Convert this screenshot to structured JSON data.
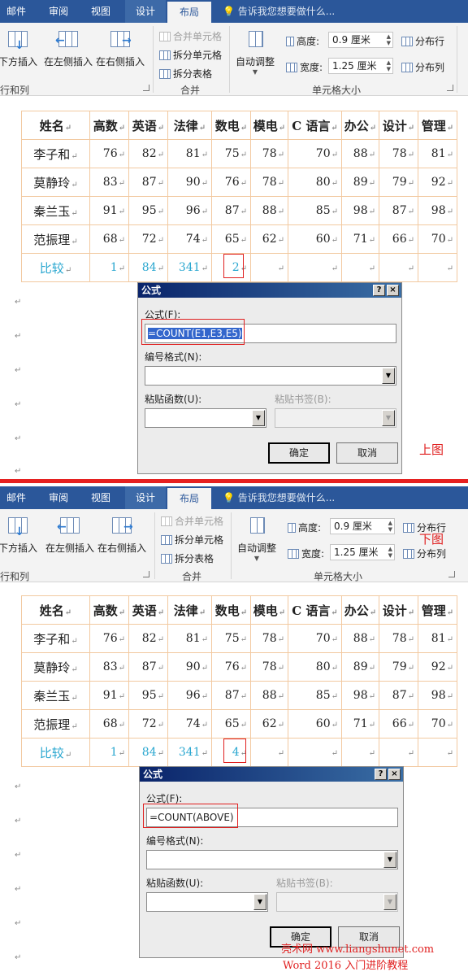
{
  "tabs": [
    "邮件",
    "审阅",
    "视图",
    "设计",
    "布局"
  ],
  "tell_me": "告诉我您想要做什么...",
  "ribbon": {
    "insert_below": "下方插入",
    "insert_left": "在左侧插入",
    "insert_right": "在右侧插入",
    "group_rows_cols": "行和列",
    "merge_cells": "合并单元格",
    "split_cells": "拆分单元格",
    "split_table": "拆分表格",
    "group_merge": "合并",
    "autofit": "自动调整",
    "height_label": "高度:",
    "height_value": "0.9 厘米",
    "width_label": "宽度:",
    "width_value": "1.25 厘米",
    "distribute_rows": "分布行",
    "distribute_cols": "分布列",
    "group_cell_size": "单元格大小"
  },
  "table": {
    "headers": [
      "姓名",
      "高数",
      "英语",
      "法律",
      "数电",
      "模电",
      "C 语言",
      "办公",
      "设计",
      "管理"
    ],
    "rows": [
      [
        "李子和",
        "76",
        "82",
        "81",
        "75",
        "78",
        "70",
        "88",
        "78",
        "81"
      ],
      [
        "莫静玲",
        "83",
        "87",
        "90",
        "76",
        "78",
        "80",
        "89",
        "79",
        "92"
      ],
      [
        "秦兰玉",
        "91",
        "95",
        "96",
        "87",
        "88",
        "85",
        "98",
        "87",
        "98"
      ],
      [
        "范振理",
        "68",
        "72",
        "74",
        "65",
        "62",
        "60",
        "71",
        "66",
        "70"
      ]
    ],
    "compare_label": "比较",
    "compare_values_top": [
      "1",
      "84",
      "341",
      "2"
    ],
    "compare_values_bottom": [
      "1",
      "84",
      "341",
      "4"
    ]
  },
  "dialog": {
    "title": "公式",
    "help": "?",
    "close": "×",
    "formula_label": "公式(F):",
    "formula_top": "=COUNT(E1,E3,E5)",
    "formula_bottom": "=COUNT(ABOVE)",
    "number_format_label": "编号格式(N):",
    "paste_function_label": "粘贴函数(U):",
    "paste_bookmark_label": "粘贴书签(B):",
    "ok": "确定",
    "cancel": "取消"
  },
  "captions": {
    "top": "上图",
    "bottom": "下图"
  },
  "watermark": {
    "line1": "亮术网 www.liangshunet.com",
    "line2": "Word 2016 入门进阶教程"
  },
  "colors": {
    "tab_bar": "#2b579a",
    "ribbon_bg": "#f3f3f3",
    "table_border": "#f2c9a0",
    "compare_text": "#2aa7d0",
    "highlight_red": "#e02020"
  }
}
